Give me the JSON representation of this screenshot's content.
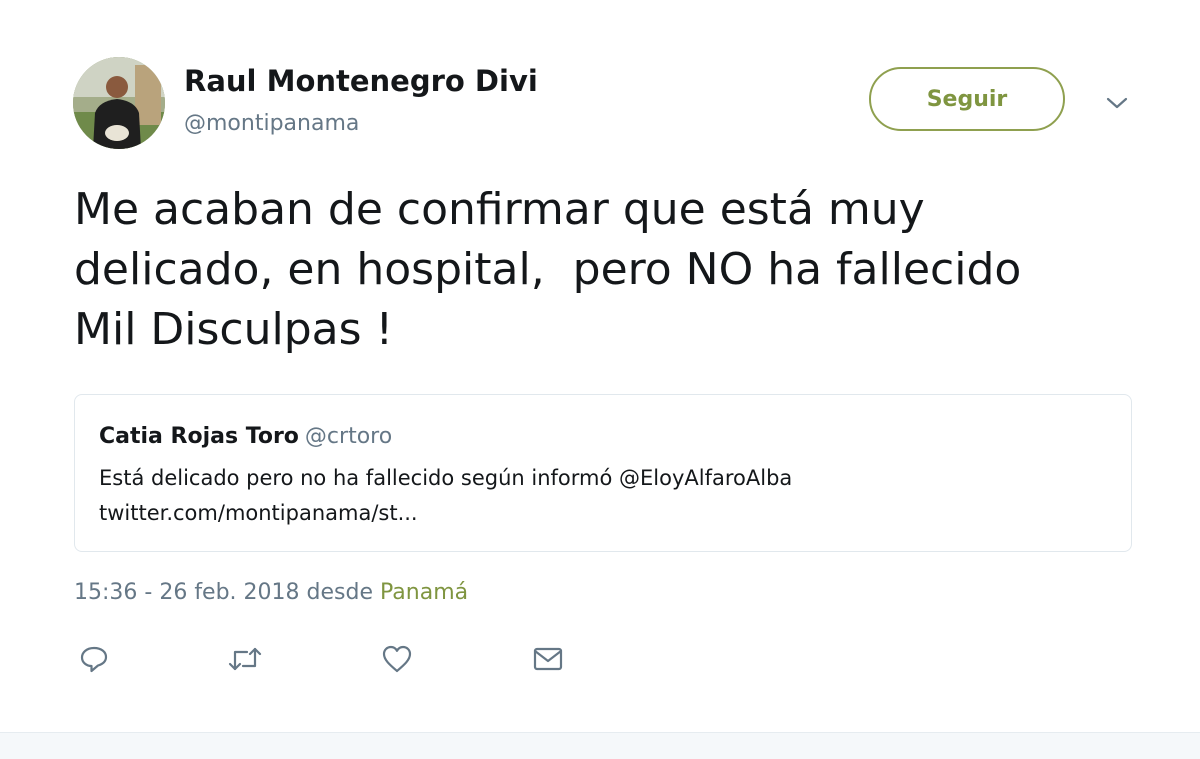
{
  "author": {
    "name": "Raul Montenegro Divi",
    "handle": "@montipanama",
    "avatar_icon": "user-photo-avatar"
  },
  "follow_button": {
    "label": "Seguir",
    "color": "#7f9540"
  },
  "menu_icon": "chevron-down-icon",
  "tweet": {
    "lines": [
      "Me acaban de confirmar que está muy",
      "delicado, en hospital,  pero NO ha fallecido",
      "Mil Disculpas !"
    ]
  },
  "quoted_tweet": {
    "name": "Catia Rojas Toro",
    "handle": "@crtoro",
    "lines": [
      "Está delicado pero no ha fallecido según informó @EloyAlfaroAlba",
      "twitter.com/montipanama/st..."
    ]
  },
  "meta": {
    "time": "15:36 - 26 feb. 2018",
    "from_label": "desde",
    "location": "Panamá"
  },
  "actions": [
    {
      "name": "reply",
      "icon": "reply-icon"
    },
    {
      "name": "retweet",
      "icon": "retweet-icon"
    },
    {
      "name": "like",
      "icon": "heart-icon"
    },
    {
      "name": "message",
      "icon": "envelope-icon"
    }
  ],
  "colors": {
    "accent": "#7f9540",
    "text": "#14171a",
    "muted": "#657786",
    "border": "#e1e8ed"
  }
}
